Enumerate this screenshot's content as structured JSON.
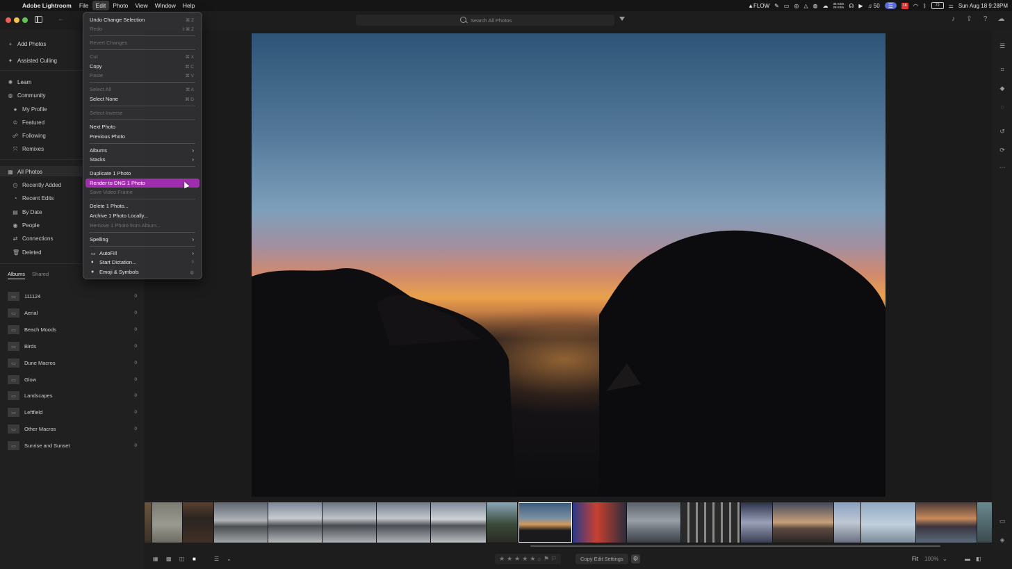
{
  "menubar": {
    "app_name": "Adobe Lightroom",
    "menus": [
      "File",
      "Edit",
      "Photo",
      "View",
      "Window",
      "Help"
    ],
    "status": {
      "flow": "FLOW",
      "net_up": "35 KB/s",
      "net_down": "29 KB/s",
      "volume": "50",
      "battery": "72",
      "calendar": "16",
      "datetime": "Sun Aug 18  9:28PM"
    }
  },
  "topbar": {
    "search_placeholder": "Search All Photos"
  },
  "sidebar": {
    "add_photos": "Add Photos",
    "assisted_culling": "Assisted Culling",
    "learn": "Learn",
    "community": "Community",
    "community_items": [
      "My Profile",
      "Featured",
      "Following",
      "Remixes"
    ],
    "all_photos": "All Photos",
    "library_items": [
      "Recently Added",
      "Recent Edits",
      "By Date",
      "People",
      "Connections",
      "Deleted"
    ],
    "album_tabs": [
      "Albums",
      "Shared"
    ],
    "albums": [
      {
        "name": "111124",
        "count": "0"
      },
      {
        "name": "Aerial",
        "count": "0"
      },
      {
        "name": "Beach Moods",
        "count": "0"
      },
      {
        "name": "Birds",
        "count": "0"
      },
      {
        "name": "Dune Macros",
        "count": "0"
      },
      {
        "name": "Glow",
        "count": "0"
      },
      {
        "name": "Landscapes",
        "count": "0"
      },
      {
        "name": "Leftfield",
        "count": "0"
      },
      {
        "name": "Other Macros",
        "count": "0"
      },
      {
        "name": "Sunrise and Sunset",
        "count": "0"
      }
    ]
  },
  "edit_menu": {
    "items": [
      {
        "label": "Undo Change Selection",
        "shortcut": "⌘ Z"
      },
      {
        "label": "Redo",
        "shortcut": "⇧⌘ Z",
        "disabled": true
      },
      {
        "label": "Revert Changes",
        "disabled": true
      },
      {
        "label": "Cut",
        "shortcut": "⌘ X",
        "disabled": true
      },
      {
        "label": "Copy",
        "shortcut": "⌘ C"
      },
      {
        "label": "Paste",
        "shortcut": "⌘ V",
        "disabled": true
      },
      {
        "label": "Select All",
        "shortcut": "⌘ A",
        "disabled": true
      },
      {
        "label": "Select None",
        "shortcut": "⌘ D"
      },
      {
        "label": "Select Inverse",
        "disabled": true
      },
      {
        "label": "Next Photo"
      },
      {
        "label": "Previous Photo"
      },
      {
        "label": "Albums"
      },
      {
        "label": "Stacks"
      },
      {
        "label": "Duplicate 1 Photo"
      },
      {
        "label": "Render to DNG 1 Photo",
        "highlighted": true
      },
      {
        "label": "Save Video Frame",
        "disabled": true
      },
      {
        "label": "Delete 1 Photo..."
      },
      {
        "label": "Archive 1 Photo Locally..."
      },
      {
        "label": "Remove 1 Photo from Album...",
        "disabled": true
      },
      {
        "label": "Spelling"
      },
      {
        "label": "AutoFill"
      },
      {
        "label": "Start Dictation..."
      },
      {
        "label": "Emoji & Symbols"
      }
    ]
  },
  "bottombar": {
    "copy_edit_settings": "Copy Edit Settings",
    "fit": "Fit",
    "zoom": "100%"
  },
  "colors": {
    "menu_highlight": "#a02cae",
    "accent_pill": "#5a6ad8"
  }
}
